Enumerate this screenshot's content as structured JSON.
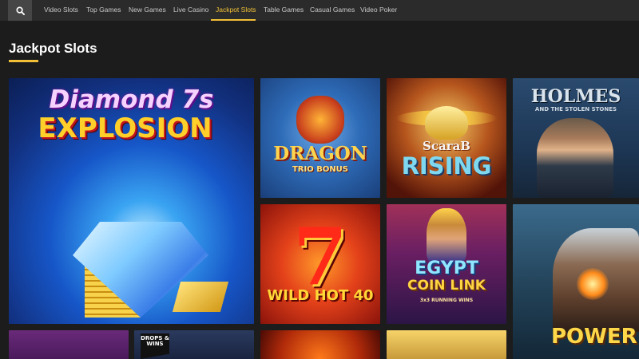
{
  "nav": {
    "search_icon": "search-icon",
    "items": [
      {
        "label": "Video Slots"
      },
      {
        "label": "Top Games"
      },
      {
        "label": "New Games"
      },
      {
        "label": "Live Casino"
      },
      {
        "label": "Jackpot Slots",
        "active": true
      },
      {
        "label": "Table Games"
      },
      {
        "label": "Casual Games"
      },
      {
        "label": "Video Poker"
      }
    ]
  },
  "section": {
    "title": "Jackpot Slots"
  },
  "games": [
    {
      "name": "Diamond Explosion 7s",
      "line1": "Diamond 7s",
      "line2": "EXPLOSION"
    },
    {
      "name": "Dragon Trio Bonus",
      "line1": "DRAGON",
      "line2": "TRIO BONUS"
    },
    {
      "name": "Scarab Rising",
      "line1": "ScaraB",
      "line2": "RISING"
    },
    {
      "name": "Holmes and the Stolen Stones",
      "line1": "HOLMES",
      "line2": "AND THE STOLEN STONES"
    },
    {
      "name": "Wild Hot 40",
      "big": "7",
      "line1": "WILD HOT 40"
    },
    {
      "name": "Egypt Coin Link",
      "line1": "EGYPT",
      "line2": "COIN LINK",
      "line3": "3x3 RUNNING WINS"
    },
    {
      "name": "Power of",
      "line1": "POWER OF"
    },
    {
      "name": "bottom-tile-1"
    },
    {
      "name": "Drops & Wins",
      "line1": "DROPS & WINS"
    },
    {
      "name": "bottom-tile-3"
    },
    {
      "name": "bottom-tile-4"
    }
  ],
  "colors": {
    "accent": "#f2c037",
    "background": "#1c1c1c",
    "nav_bg": "#2b2b2b"
  }
}
